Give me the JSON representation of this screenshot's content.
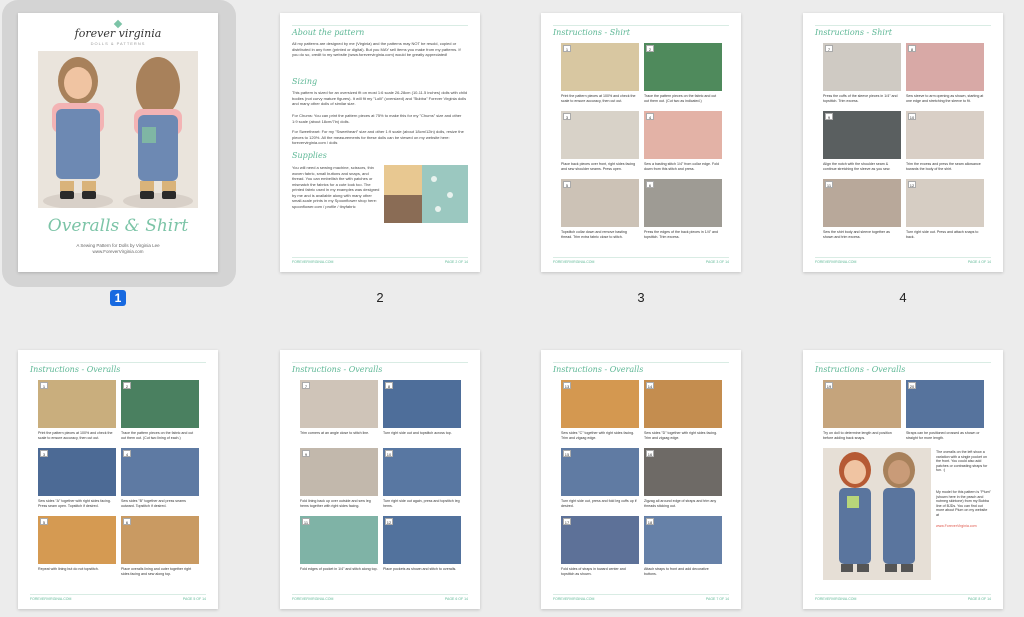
{
  "pages": [
    {
      "number": "1",
      "selected": true
    },
    {
      "number": "2",
      "selected": false
    },
    {
      "number": "3",
      "selected": false
    },
    {
      "number": "4",
      "selected": false
    },
    {
      "number": "",
      "selected": false
    },
    {
      "number": "",
      "selected": false
    },
    {
      "number": "",
      "selected": false
    },
    {
      "number": "",
      "selected": false
    }
  ],
  "cover": {
    "brand": "forever virginia",
    "brand_sub": "DOLLS & PATTERNS",
    "title": "Overalls & Shirt",
    "subtitle": "A Sewing Pattern for Dolls by Virginia Lee",
    "url": "www.ForeverVirginia.com"
  },
  "page2": {
    "h1": "About the pattern",
    "p1": "All my patterns are designed by me (Virginia) and the patterns may NOT be resold, copied or distributed in any form (printed or digital). But you MAY sell items you make from my patterns. If you do so, credit to my website (www.forevervirginia.com) would be greatly appreciated!",
    "h2": "Sizing",
    "p2": "This pattern is sized for an oversized fit on most 1:6 scale 26-28cm (10-11.5 inches) dolls with child bodies (not curvy mature figures). It will fit my \"Lolli\" (oversized) and \"Bubba\" Forever Virginia dolls and many other dolls of similar size.",
    "p3": "For Chums: You can print the pattern pieces at 75% to make this for my \"Chums\" size and other 1:9 scale (about 18cm/7in) dolls.",
    "p4": "For Sweetheart: For my \"Sweetheart\" size and other 1:9 scale (about 18cm/12in) dolls, resize the pieces to 120%. All the measurements for these dolls can be viewed on my website here: forevervirginia.com / dolls",
    "h3": "Supplies",
    "p5": "You will need a sewing machine, scissors, thin woven fabric, small buttons and snaps, and thread. You can embellish the with patches or mismatch the fabrics for a cute look too. The printed fabric used in my examples was designed by me and is available along with many other small-scale prints in my Spoonflower shop here: spoonflower.com / profile / tinyfabric",
    "foot_left": "FOREVERVIRGINIA.COM",
    "foot_right": "PAGE 2 OF 14"
  },
  "page3": {
    "heading": "Instructions - Shirt",
    "captions": [
      "Print the pattern pieces at 100% and check the scale to ensure accuracy, then cut out.",
      "Trace the pattern pieces on the fabric and cut out them out. (Cut two as indicated.)",
      "Place back pieces over front, right sides facing and sew shoulder seams. Press open.",
      "Sew a basting stitch 1/4\" from collar edge. Fold down from this stitch and press.",
      "Topstitch collar down and remove basting thread. Trim extra fabric close to stitch.",
      "Press the edges of the back pieces in 1/4\" and topstitch. Trim excess."
    ],
    "foot_left": "FOREVERVIRGINIA.COM",
    "foot_right": "PAGE 3 OF 14"
  },
  "page4": {
    "heading": "Instructions - Shirt",
    "captions": [
      "Press the cuffs of the sleeve pieces in 1/4\" and topstitch. Trim excess.",
      "Sew sleeve to arm opening as shown, starting at one edge and stretching the sleeve to fit.",
      "Align the notch with the shoulder seam & continue stretching the sleeve as you sew.",
      "Trim the excess and press the seam allowance towards the body of the shirt.",
      "Sew the shirt body and sleeve together as shown and trim excess.",
      "Turn right side out. Press and attach snaps to back."
    ],
    "foot_left": "FOREVERVIRGINIA.COM",
    "foot_right": "PAGE 4 OF 14"
  },
  "page5": {
    "heading": "Instructions - Overalls",
    "captions": [
      "Print the pattern pieces at 100% and check the scale to ensure accuracy, then cut out.",
      "Trace the pattern pieces on the fabric and cut out them out. (Cut two lining of each.)",
      "Sew sides \"A\" together with right sides facing. Press seam open. Topstitch if desired.",
      "Sew sides \"B\" together and press seams outward. Topstitch if desired.",
      "Repeat with lining but do not topstitch.",
      "Place overalls lining and outer together right sides facing and sew along top."
    ],
    "foot_left": "FOREVERVIRGINIA.COM",
    "foot_right": "PAGE 5 OF 14"
  },
  "page6": {
    "heading": "Instructions - Overalls",
    "captions": [
      "Trim corners at an angle close to stitch line.",
      "Turn right side out and topstitch across top.",
      "Fold lining back up over outside and sew leg hems together with right sides facing.",
      "Turn right side out again, press and topstitch leg hems.",
      "Fold edges of pocket in 1/4\" and stitch along top.",
      "Place pockets as shown and stitch to overalls."
    ],
    "foot_left": "FOREVERVIRGINIA.COM",
    "foot_right": "PAGE 6 OF 14"
  },
  "page7": {
    "heading": "Instructions - Overalls",
    "captions": [
      "Sew sides \"C\" together with right sides facing. Trim and zigzag edge.",
      "Sew sides \"D\" together with right sides facing. Trim and zigzag edge.",
      "Turn right side out, press and fold leg cuffs up if desired.",
      "Zigzag all around edge of straps and trim any threads sticking out.",
      "Fold sides of straps in toward center and topstitch as shown.",
      "Attach straps to front and add decorative buttons."
    ],
    "foot_left": "FOREVERVIRGINIA.COM",
    "foot_right": "PAGE 7 OF 14"
  },
  "page8": {
    "heading": "Instructions - Overalls",
    "captions": [
      "Try on doll to determine length and position before adding back snaps.",
      "Straps can be positioned crossed as shown or straight for more length."
    ],
    "note": "The overalls on the left show a variation with a single pocket on the front. You could also add patches or contrasting straps for fun. :)",
    "note2": "My model for this pattern is \"Plum\" (shown here in the peach and nutmeg skintone) from my Bubba line of BJDs. You can find out more about Plum on my website at",
    "link": "www.ForeverVirginia.com",
    "foot_left": "FOREVERVIRGINIA.COM",
    "foot_right": "PAGE 8 OF 14"
  }
}
